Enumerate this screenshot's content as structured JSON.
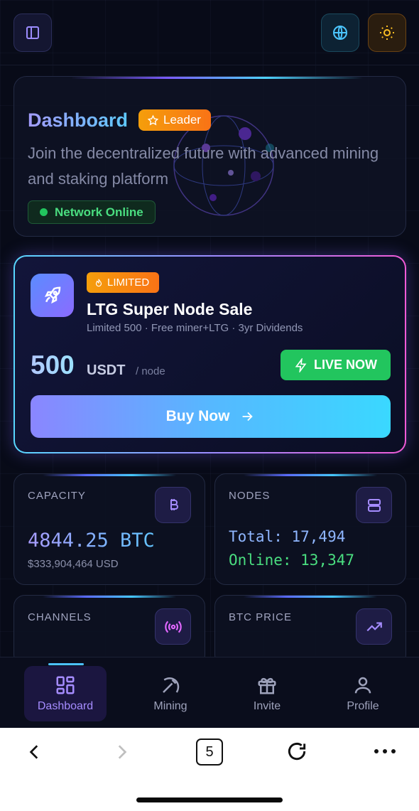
{
  "hero": {
    "title": "Dashboard",
    "badge": "Leader",
    "subtitle": "Join the decentralized future with advanced mining and staking platform",
    "status": "Network Online"
  },
  "sale": {
    "badge": "LIMITED",
    "title": "LTG Super Node Sale",
    "subtitle": "Limited 500 · Free miner+LTG · 3yr Dividends",
    "price": "500",
    "unit": "USDT",
    "per": "/ node",
    "live_label": "LIVE NOW",
    "buy_label": "Buy Now"
  },
  "stats": {
    "capacity": {
      "label": "CAPACITY",
      "value": "4844.25 BTC",
      "usd": "$333,904,464 USD"
    },
    "nodes": {
      "label": "NODES",
      "total": "Total: 17,494",
      "online": "Online: 13,347"
    },
    "channels": {
      "label": "CHANNELS"
    },
    "btc_price": {
      "label": "BTC PRICE"
    }
  },
  "nav": {
    "items": [
      {
        "label": "Dashboard",
        "icon": "grid-icon",
        "active": true
      },
      {
        "label": "Mining",
        "icon": "pickaxe-icon",
        "active": false
      },
      {
        "label": "Invite",
        "icon": "gift-icon",
        "active": false
      },
      {
        "label": "Profile",
        "icon": "user-icon",
        "active": false
      }
    ]
  },
  "browser": {
    "tab_count": "5"
  },
  "colors": {
    "accent": "#8b6bff",
    "success": "#22c55e",
    "warning": "#f59e0b",
    "cyan": "#45c8ff"
  }
}
